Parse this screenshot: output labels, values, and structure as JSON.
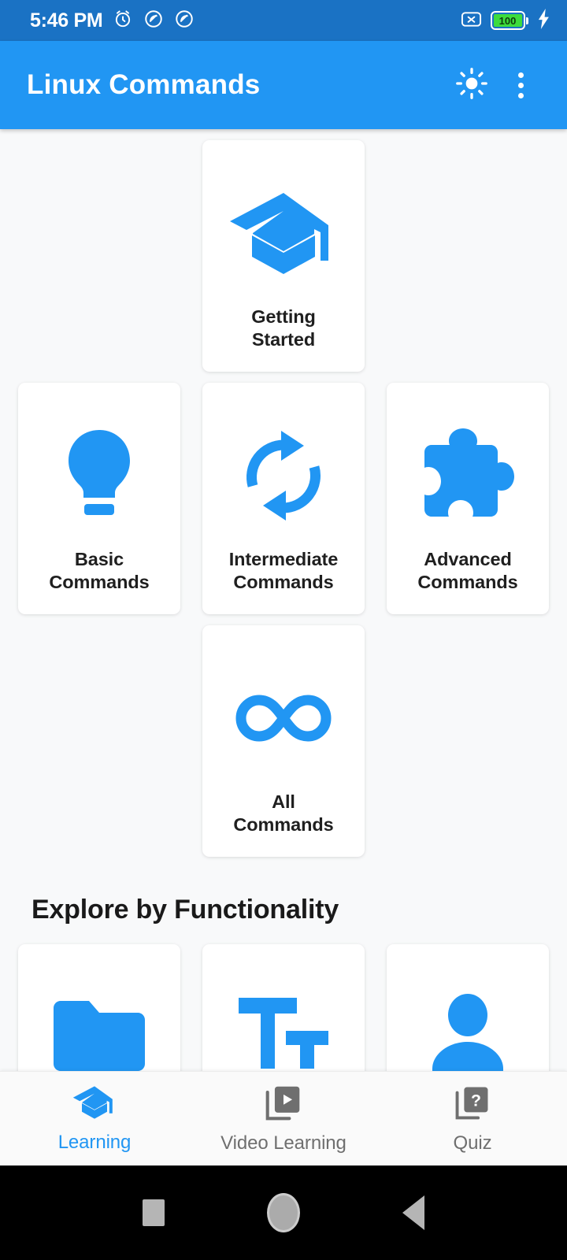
{
  "status_bar": {
    "time": "5:46 PM",
    "battery_percent": "100",
    "icons": [
      "alarm-icon",
      "dnd-icon",
      "dnd-icon",
      "no-sim-icon",
      "battery-icon",
      "charging-bolt-icon"
    ]
  },
  "app_bar": {
    "title": "Linux Commands",
    "brightness_icon": "brightness-sun-icon",
    "overflow_icon": "overflow-menu-icon"
  },
  "main": {
    "top_card": {
      "label": "Getting\nStarted",
      "label_line1": "Getting",
      "label_line2": "Started",
      "icon": "graduation-cap-icon"
    },
    "level_cards": [
      {
        "label_line1": "Basic",
        "label_line2": "Commands",
        "icon": "lightbulb-icon"
      },
      {
        "label_line1": "Intermediate",
        "label_line2": "Commands",
        "icon": "sync-refresh-icon"
      },
      {
        "label_line1": "Advanced",
        "label_line2": "Commands",
        "icon": "puzzle-piece-icon"
      }
    ],
    "all_card": {
      "label_line1": "All",
      "label_line2": "Commands",
      "icon": "infinity-icon"
    },
    "section_title": "Explore by Functionality",
    "functionality_cards": [
      {
        "icon": "folder-icon"
      },
      {
        "icon": "text-format-icon"
      },
      {
        "icon": "person-icon"
      }
    ]
  },
  "bottom_nav": {
    "items": [
      {
        "label": "Learning",
        "icon": "graduation-cap-icon",
        "active": true
      },
      {
        "label": "Video Learning",
        "icon": "video-library-icon",
        "active": false
      },
      {
        "label": "Quiz",
        "icon": "quiz-question-icon",
        "active": false
      }
    ]
  },
  "system_nav": {
    "recents": "recents-square-icon",
    "home": "home-circle-icon",
    "back": "back-triangle-icon"
  },
  "colors": {
    "status_bar": "#1a72c4",
    "app_bar": "#2196f3",
    "accent": "#2196f3",
    "background": "#f8f9fa",
    "card": "#ffffff",
    "battery": "#3ddc3d"
  }
}
